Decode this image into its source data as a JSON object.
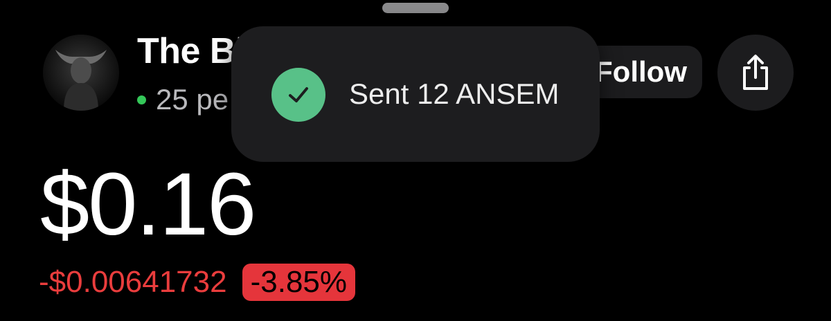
{
  "header": {
    "title": "The Bl",
    "online_count_text": "25 pe",
    "follow_label": "Follow",
    "share_icon": "share-icon",
    "avatar_icon": "bull-avatar"
  },
  "token": {
    "price": "$0.16",
    "change_abs": "-$0.00641732",
    "change_pct": "-3.85%"
  },
  "toast": {
    "message": "Sent 12 ANSEM",
    "icon": "check-icon"
  },
  "colors": {
    "background": "#000000",
    "online": "#34c759",
    "negative": "#ea3d3d",
    "toast_check": "#58c188"
  }
}
